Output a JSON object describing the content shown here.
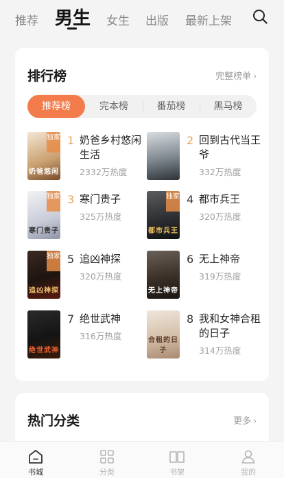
{
  "topnav": {
    "tabs": [
      "推荐",
      "男生",
      "女生",
      "出版",
      "最新上架"
    ],
    "active_tab": "男生"
  },
  "ranking": {
    "title": "排行榜",
    "more": "完整榜单",
    "segments": [
      "推荐榜",
      "完本榜",
      "番茄榜",
      "黑马榜"
    ],
    "active_segment": "推荐榜",
    "books": [
      {
        "rank": "1",
        "title": "奶爸乡村悠闲生活",
        "heat": "2332万热度",
        "badge": "独家",
        "cover_text": "奶爸悠闲"
      },
      {
        "rank": "2",
        "title": "回到古代当王爷",
        "heat": "332万热度",
        "badge": "",
        "cover_text": ""
      },
      {
        "rank": "3",
        "title": "寒门贵子",
        "heat": "325万热度",
        "badge": "独家",
        "cover_text": "寒门贵子"
      },
      {
        "rank": "4",
        "title": "都市兵王",
        "heat": "320万热度",
        "badge": "独家",
        "cover_text": "都市兵王"
      },
      {
        "rank": "5",
        "title": "追凶神探",
        "heat": "320万热度",
        "badge": "独家",
        "cover_text": "追凶神探"
      },
      {
        "rank": "6",
        "title": "无上神帝",
        "heat": "319万热度",
        "badge": "",
        "cover_text": "无上神帝"
      },
      {
        "rank": "7",
        "title": "绝世武神",
        "heat": "316万热度",
        "badge": "",
        "cover_text": "绝世武神"
      },
      {
        "rank": "8",
        "title": "我和女神合租的日子",
        "heat": "314万热度",
        "badge": "",
        "cover_text": "合租的日子"
      }
    ]
  },
  "categories": {
    "title": "热门分类",
    "more": "更多"
  },
  "bottombar": {
    "items": [
      "书城",
      "分类",
      "书架",
      "我的"
    ],
    "active": "书城"
  },
  "colors": {
    "accent": "#f27c4c",
    "rank_top3": "#e8a060",
    "rank_other": "#333333"
  }
}
